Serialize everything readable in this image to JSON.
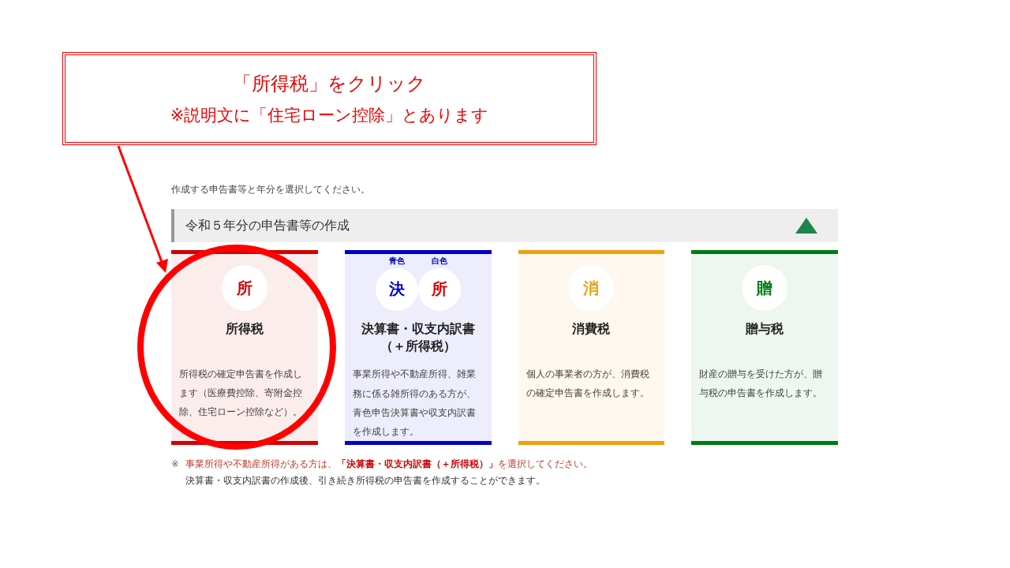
{
  "callout": {
    "lines": [
      "「所得税」をクリック",
      "※説明文に「住宅ローン控除」とあります"
    ]
  },
  "intro": "作成する申告書等と年分を選択してください。",
  "section": {
    "title": "令和５年分の申告書等の作成",
    "expanded": true
  },
  "cards": [
    {
      "color": "#d40000",
      "badges": [
        {
          "glyph": "所",
          "color": "#d40000"
        }
      ],
      "title": "所得税",
      "description": "所得税の確定申告書を作成します（医療費控除、寄附金控除、住宅ローン控除など）。"
    },
    {
      "color": "#0000c8",
      "badges": [
        {
          "tag": "青色",
          "glyph": "決",
          "color": "#0000c8"
        },
        {
          "tag": "白色",
          "glyph": "所",
          "color": "#d40000"
        }
      ],
      "title": "決算書・収支内訳書（＋所得税）",
      "description": "事業所得や不動産所得、雑業務に係る雑所得のある方が、青色申告決算書や収支内訳書を作成します。"
    },
    {
      "color": "#f0a010",
      "badges": [
        {
          "glyph": "消",
          "color": "#f0a010"
        }
      ],
      "title": "消費税",
      "description": "個人の事業者の方が、消費税の確定申告書を作成します。"
    },
    {
      "color": "#007a14",
      "badges": [
        {
          "glyph": "贈",
          "color": "#007a14"
        }
      ],
      "title": "贈与税",
      "description": "財産の贈与を受けた方が、贈与税の申告書を作成します。"
    }
  ],
  "note": {
    "mark": "※",
    "lines": [
      "事業所得や不動産所得がある方は、**「決算書・収支内訳書（＋所得税）」**を選択してください。",
      "決算書・収支内訳書の作成後、引き続き所得税の申告書を作成することができます。"
    ]
  }
}
